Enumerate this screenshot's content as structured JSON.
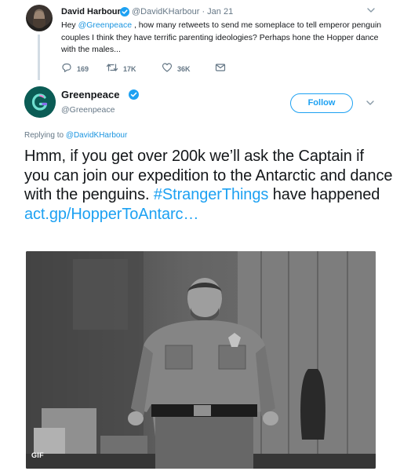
{
  "reply_tweet": {
    "author_name": "David Harbour",
    "author_handle": "@DavidKHarbour",
    "date": "Jan 21",
    "text_before": "Hey ",
    "mention": "@Greenpeace",
    "text_after": " , how many retweets to send me someplace to tell emperor penguin couples I think they have terrific parenting ideologies?  Perhaps hone the Hopper dance with the males...",
    "counts": {
      "replies": "169",
      "retweets": "17K",
      "likes": "36K"
    },
    "icons": [
      "reply-icon",
      "retweet-icon",
      "like-icon",
      "message-icon",
      "chevron-down-icon"
    ]
  },
  "main_tweet": {
    "author_name": "Greenpeace",
    "author_handle": "@Greenpeace",
    "follow_label": "Follow",
    "replying_prefix": "Replying to ",
    "replying_to": "@DavidKHarbour",
    "text": "Hmm, if you get over 200k we’ll ask the Captain if you can join our expedition to the Antarctic and dance with the penguins. ",
    "hashtag": "#StrangerThings",
    "text_mid": " have happened ",
    "link": "act.gp/HopperToAntarc…",
    "media_badge": "GIF",
    "icons": [
      "greenpeace-logo-icon",
      "verified-icon",
      "chevron-down-icon"
    ]
  },
  "colors": {
    "accent": "#1da1f2",
    "mention": "#1b95e0",
    "muted": "#657786",
    "text": "#14171a",
    "greenpeace_avatar": "#0b5c55"
  }
}
